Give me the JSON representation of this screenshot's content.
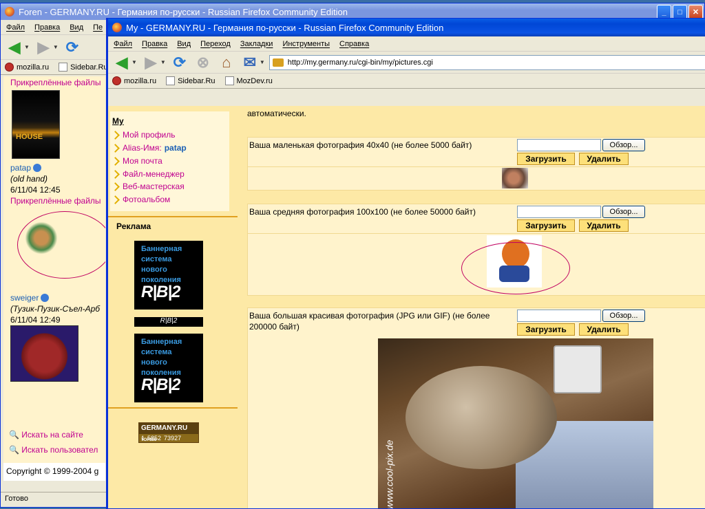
{
  "back_window": {
    "title": "Foren - GERMANY.RU - Германия по-русски - Russian Firefox Community Edition",
    "menu": [
      "Файл",
      "Правка",
      "Вид",
      "Пе"
    ],
    "bookmarks": [
      "mozilla.ru",
      "Sidebar.Ru"
    ],
    "attached_files_top": "Прикреплённые файлы",
    "post1": {
      "nick": "patap",
      "role": "(old hand)",
      "date": "6/11/04 12:45",
      "attached": "Прикреплённые файлы"
    },
    "post2": {
      "nick": "sweiger",
      "role": "(Тузик-Пузик-Съел-Арб",
      "date": "6/11/04 12:49"
    },
    "house_label": "HOUSE",
    "search_site": "Искать на сайте",
    "search_user": "Искать пользовател",
    "copyright": "Copyright © 1999-2004 g",
    "status": "Готово"
  },
  "front_window": {
    "title": "My - GERMANY.RU - Германия по-русски - Russian Firefox Community Edition",
    "menu": [
      "Файл",
      "Правка",
      "Вид",
      "Переход",
      "Закладки",
      "Инструменты",
      "Справка"
    ],
    "url": "http://my.germany.ru/cgi-bin/my/pictures.cgi",
    "bookmarks": [
      "mozilla.ru",
      "Sidebar.Ru",
      "MozDev.ru"
    ],
    "sidebar": {
      "title": "My",
      "items": [
        {
          "label": "Мой профиль"
        },
        {
          "label": "Alias-Имя: ",
          "value": "patap"
        },
        {
          "label": "Моя почта"
        },
        {
          "label": "Файл-менеджер"
        },
        {
          "label": "Веб-мастерская"
        },
        {
          "label": "Фотоальбом"
        }
      ],
      "ads_title": "Реклама",
      "banner_lines": [
        "Баннерная",
        "система",
        "нового",
        "поколения"
      ],
      "banner_logo": "R|B|2",
      "counter": {
        "brand": "GERMANY.RU",
        "tag": "TOP100",
        "rank": "1",
        "v1": "5852",
        "v2": "73927"
      }
    },
    "intro_text": "автоматически.",
    "panels": [
      {
        "label": "Ваша маленькая фотография 40x40 (не более 5000 байт)"
      },
      {
        "label": "Ваша средняя фотография 100x100 (не более 50000 байт)"
      },
      {
        "label": "Ваша большая красивая фотография (JPG или GIF) (не более 200000 байт)"
      }
    ],
    "browse_label": "Обзор...",
    "upload_label": "Загрузить",
    "delete_label": "Удалить",
    "watermark": "www.cool-pix.de"
  }
}
